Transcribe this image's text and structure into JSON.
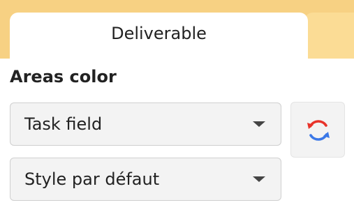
{
  "tabs": [
    {
      "label": "Deliverable",
      "active": true
    },
    {
      "label": "",
      "active": false
    }
  ],
  "areas": {
    "title": "Areas color",
    "field_dropdown": {
      "value": "Task field"
    },
    "style_dropdown": {
      "value": "Style par défaut"
    },
    "refresh_icon": "refresh-icon"
  },
  "colors": {
    "tab_strip": "#f7d183",
    "inactive_tab": "#fbdc95",
    "refresh_red": "#e8332a",
    "refresh_blue": "#3b78e7"
  }
}
